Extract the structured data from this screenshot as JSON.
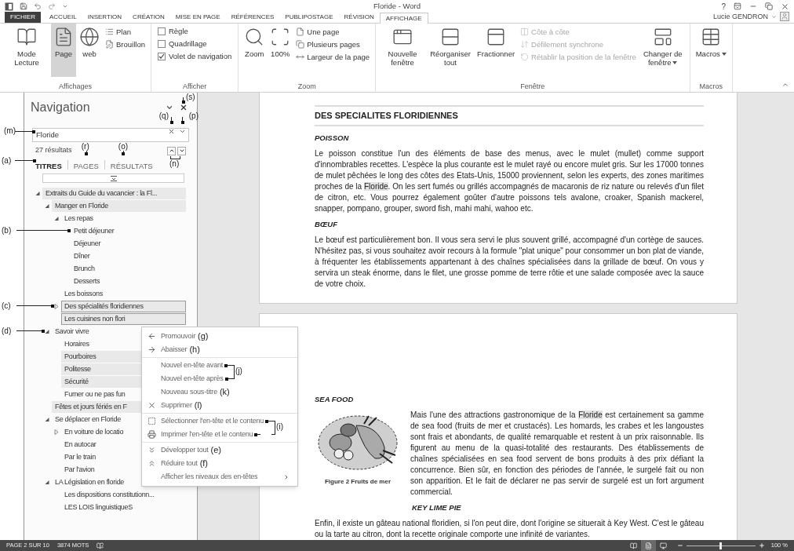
{
  "title_bar": {
    "title": "Floride - Word",
    "help": "?"
  },
  "ribbon_tabs": [
    {
      "label": "FICHIER",
      "kind": "file",
      "selected": false
    },
    {
      "label": "ACCUEIL",
      "kind": "tab",
      "selected": false
    },
    {
      "label": "INSERTION",
      "kind": "tab",
      "selected": false
    },
    {
      "label": "CRÉATION",
      "kind": "tab",
      "selected": false
    },
    {
      "label": "MISE EN PAGE",
      "kind": "tab",
      "selected": false
    },
    {
      "label": "RÉFÉRENCES",
      "kind": "tab",
      "selected": false
    },
    {
      "label": "PUBLIPOSTAGE",
      "kind": "tab",
      "selected": false
    },
    {
      "label": "RÉVISION",
      "kind": "tab",
      "selected": false
    },
    {
      "label": "AFFICHAGE",
      "kind": "tab",
      "selected": true
    }
  ],
  "user": {
    "name": "Lucie GENDRON"
  },
  "ribbon": {
    "groups": [
      {
        "label": "Affichages",
        "items": [
          {
            "kind": "large",
            "label": "Mode Lecture",
            "selected": false,
            "dropdown": false
          },
          {
            "kind": "large",
            "label": "Page",
            "selected": true,
            "dropdown": false
          },
          {
            "kind": "large",
            "label": "web",
            "selected": false,
            "dropdown": false
          },
          {
            "kind": "stack",
            "items": [
              {
                "label": "Plan",
                "disabled": false
              },
              {
                "label": "Brouillon",
                "disabled": false
              }
            ]
          }
        ]
      },
      {
        "label": "Afficher",
        "items": [
          {
            "kind": "checks",
            "items": [
              {
                "label": "Règle",
                "checked": false
              },
              {
                "label": "Quadrillage",
                "checked": false
              },
              {
                "label": "Volet de navigation",
                "checked": true
              }
            ]
          }
        ]
      },
      {
        "label": "Zoom",
        "items": [
          {
            "kind": "large",
            "label": "Zoom",
            "selected": false,
            "dropdown": false
          },
          {
            "kind": "large",
            "label": "100%",
            "selected": false,
            "dropdown": false
          },
          {
            "kind": "stack",
            "items": [
              {
                "label": "Une page",
                "disabled": false
              },
              {
                "label": "Plusieurs pages",
                "disabled": false
              },
              {
                "label": "Largeur de la page",
                "disabled": false
              }
            ]
          }
        ]
      },
      {
        "label": "Fenêtre",
        "items": [
          {
            "kind": "large",
            "label": "Nouvelle fenêtre",
            "selected": false,
            "dropdown": false
          },
          {
            "kind": "large",
            "label": "Réorganiser tout",
            "selected": false,
            "dropdown": false
          },
          {
            "kind": "large",
            "label": "Fractionner",
            "selected": false,
            "dropdown": false
          },
          {
            "kind": "stack",
            "items": [
              {
                "label": "Côte à côte",
                "disabled": true
              },
              {
                "label": "Défilement synchrone",
                "disabled": true
              },
              {
                "label": "Rétablir la position de la fenêtre",
                "disabled": true
              }
            ]
          },
          {
            "kind": "large",
            "label": "Changer de fenêtre",
            "selected": false,
            "dropdown": true
          }
        ]
      },
      {
        "label": "Macros",
        "items": [
          {
            "kind": "large",
            "label": "Macros",
            "selected": false,
            "dropdown": true
          }
        ]
      }
    ]
  },
  "navigation": {
    "title": "Navigation",
    "close_callout": "(s)",
    "search": {
      "value": "Floride",
      "callout": "(m)",
      "clear_callout": "(q)",
      "options_callout": "(p)"
    },
    "results": "27 résultats",
    "results_nav_callout": "(n)",
    "tabs": [
      {
        "label": "TITRES",
        "selected": true,
        "callout": "(a)"
      },
      {
        "label": "PAGES",
        "selected": false,
        "callout": "(r)"
      },
      {
        "label": "RÉSULTATS",
        "selected": false,
        "callout": "(o)"
      }
    ],
    "tree": [
      {
        "label": "Extraits du Guide du vacancier : la Fl...",
        "expanded": true,
        "highlighted": true,
        "selected": false,
        "children": [
          {
            "label": "Manger en Floride",
            "expanded": true,
            "highlighted": true,
            "selected": false,
            "children": [
              {
                "label": "Les repas",
                "expanded": true,
                "highlighted": false,
                "selected": false,
                "children": [
                  {
                    "label": "Petit déjeuner",
                    "highlighted": false,
                    "selected": false,
                    "callout": "(b)"
                  },
                  {
                    "label": "Déjeuner",
                    "highlighted": false,
                    "selected": false
                  },
                  {
                    "label": "Dîner",
                    "highlighted": false,
                    "selected": false
                  },
                  {
                    "label": "Brunch",
                    "highlighted": false,
                    "selected": false
                  },
                  {
                    "label": "Desserts",
                    "highlighted": false,
                    "selected": false
                  }
                ]
              },
              {
                "label": "Les boissons",
                "highlighted": false,
                "selected": false
              },
              {
                "label": "Des spécialités floridiennes",
                "expanded": false,
                "highlighted": true,
                "selected": true,
                "callout": "(c)"
              },
              {
                "label": "Les cuisines non flori",
                "highlighted": true,
                "selected": true
              }
            ]
          },
          {
            "label": "Savoir vivre",
            "expanded": true,
            "highlighted": false,
            "selected": false,
            "callout": "(d)",
            "children": [
              {
                "label": "Horaires",
                "highlighted": false,
                "selected": false
              },
              {
                "label": "Pourboires",
                "highlighted": true,
                "selected": false
              },
              {
                "label": "Politesse",
                "highlighted": true,
                "selected": false
              },
              {
                "label": "Sécurité",
                "highlighted": true,
                "selected": false
              },
              {
                "label": "Fumer ou ne pas fun",
                "highlighted": false,
                "selected": false
              }
            ]
          },
          {
            "label": "Fêtes et jours fériés en F",
            "highlighted": true,
            "selected": false
          },
          {
            "label": "Se déplacer en Floride",
            "expanded": true,
            "highlighted": false,
            "selected": false,
            "children": [
              {
                "label": "En voiture de locatio",
                "expanded": false,
                "highlighted": false,
                "selected": false
              },
              {
                "label": "En autocar",
                "highlighted": false,
                "selected": false
              },
              {
                "label": "Par le train",
                "highlighted": false,
                "selected": false
              },
              {
                "label": "Par l'avion",
                "highlighted": false,
                "selected": false
              }
            ]
          },
          {
            "label": "LA Législation en floride",
            "expanded": true,
            "highlighted": false,
            "selected": false,
            "children": [
              {
                "label": "Les dispositions constitutionn...",
                "highlighted": false,
                "selected": false
              },
              {
                "label": "LES LOIS linguistiqueS",
                "highlighted": false,
                "selected": false
              }
            ]
          }
        ]
      }
    ]
  },
  "context_menu": {
    "groups": [
      [
        {
          "label": "Promouvoir",
          "kind": "command",
          "callout": "(g)"
        },
        {
          "label": "Abaisser",
          "kind": "command",
          "callout": "(h)"
        }
      ],
      [
        {
          "label": "Nouvel en-tête avant",
          "kind": "command",
          "bracket": "(j)"
        },
        {
          "label": "Nouvel en-tête après",
          "kind": "command"
        },
        {
          "label": "Nouveau sous-titre",
          "kind": "command",
          "callout": "(k)"
        },
        {
          "label": "Supprimer",
          "kind": "command",
          "callout": "(l)"
        }
      ],
      [
        {
          "label": "Sélectionner l'en-tête et le contenu",
          "kind": "command",
          "bracket": "(i)"
        },
        {
          "label": "Imprimer l'en-tête et le contenu",
          "kind": "command"
        }
      ],
      [
        {
          "label": "Développer tout",
          "kind": "command",
          "callout": "(e)"
        },
        {
          "label": "Réduire tout",
          "kind": "command",
          "callout": "(f)"
        },
        {
          "label": "Afficher les niveaux des en-têtes",
          "kind": "submenu"
        }
      ]
    ]
  },
  "document": {
    "pages": [
      {
        "blocks": [
          {
            "kind": "heading",
            "text": "DES SPECIALITES FLORIDIENNES"
          },
          {
            "kind": "subheading",
            "text": "POISSON",
            "indented": false
          },
          {
            "kind": "paragraph",
            "segments": [
              {
                "kind": "text",
                "text": "Le poisson constitue l'un des éléments de base des menus, avec le mulet (mullet) comme support d'innombrables recettes. L'espèce la plus courante est le mulet rayé ou encore mulet gris. Sur les 17000 tonnes de mulet pêchées le long des côtes des Etats-Unis, 15000 proviennent, selon les experts, des zones maritimes proches de la "
              },
              {
                "kind": "match",
                "text": "Floride"
              },
              {
                "kind": "text",
                "text": ". On les sert fumés ou grillés accompagnés de macaronis de riz nature ou relevés d'un filet de citron, etc. Vous pourrez également goûter d'autre poissons tels avalone, croaker, Spanish mackerel, snapper, pompano, grouper, sword fish, mahi mahi, wahoo etc."
              }
            ]
          },
          {
            "kind": "subheading",
            "text": "BŒUF",
            "indented": false
          },
          {
            "kind": "paragraph",
            "segments": [
              {
                "kind": "text",
                "text": "Le bœuf est particulièrement bon. Il vous sera servi le plus souvent grillé, accompagné d'un cortège de sauces. N'hésitez pas, si vous souhaitez avoir recours à la formule \"plat unique\" pour consommer un bon plat de viande, à fréquenter les établissements appartenant à des chaînes spécialisées dans la grillade de bœuf. On vous y servira un steak énorme, dans le filet, une grosse pomme de terre rôtie et une salade composée avec la sauce de votre choix."
              }
            ]
          }
        ]
      },
      {
        "blocks": [
          {
            "kind": "subheading",
            "text": "SEA FOOD",
            "indented": false
          },
          {
            "kind": "figure",
            "caption": "Figure 2 Fruits de mer",
            "segments": [
              {
                "kind": "text",
                "text": "Mais l'une des attractions gastronomique de la "
              },
              {
                "kind": "match",
                "text": "Floride"
              },
              {
                "kind": "text",
                "text": " est certainement sa gamme de sea food (fruits de mer et crustacés). Les homards, les crabes et les langoustes sont frais et abondants, de qualité remarquable et restent à un prix raisonnable. Ils figurent au menu de la quasi-totalité des restaurants. Des établissements de chaînes spécialisées en sea food servent de bons produits à des prix défiant la concurrence. Bien sûr, en fonction des périodes de l'année, le surgelé fait ou non son apparition. Et le fait de déclarer ne pas servir de surgelé est un fort argument commercial."
              }
            ]
          },
          {
            "kind": "subheading",
            "text": "KEY LIME PIE",
            "indented": true
          },
          {
            "kind": "paragraph",
            "segments": [
              {
                "kind": "text",
                "text": "Enfin, il existe un gâteau national floridien, si l'on peut dire, dont l'origine se situerait à Key West. C'est le gâteau ou la tarte au citron, dont la recette originale comporte une infinité de variantes."
              }
            ]
          }
        ]
      }
    ]
  },
  "status_bar": {
    "page": "PAGE 2 SUR 10",
    "words": "3874 MOTS",
    "views": [
      {
        "selected": false
      },
      {
        "selected": true
      },
      {
        "selected": false
      }
    ],
    "zoom": {
      "level": 0.5,
      "reading": "100 %"
    }
  }
}
